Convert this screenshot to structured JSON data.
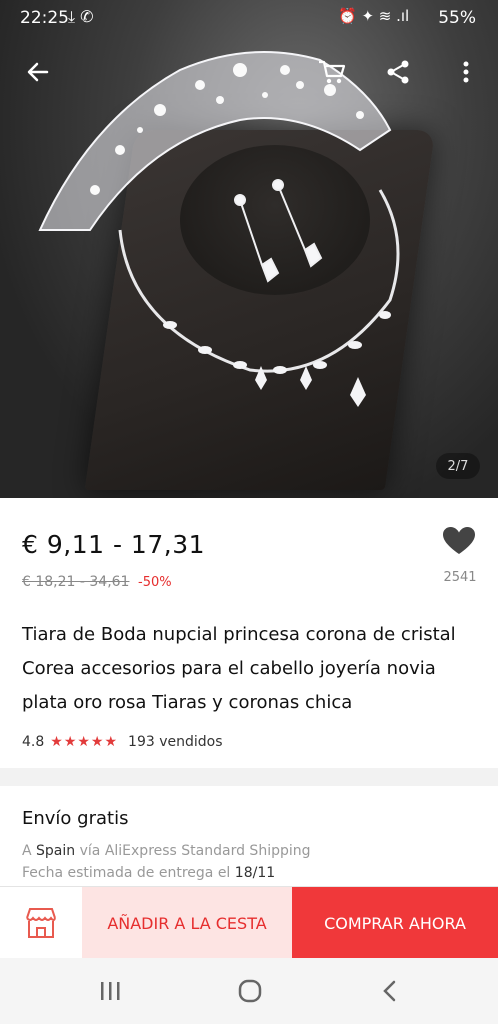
{
  "status_bar": {
    "time": "22:25",
    "battery": "55%"
  },
  "gallery": {
    "pager": "2/7"
  },
  "product": {
    "price": "€ 9,11 - 17,31",
    "old_price": "€ 18,21 - 34,61",
    "discount": "-50%",
    "wishlist_count": "2541",
    "title": "Tiara de Boda nupcial princesa corona de cristal Corea accesorios para el cabello joyería novia plata oro rosa Tiaras y coronas chica",
    "rating": "4.8",
    "stars": "★★★★★",
    "sold": "193 vendidos"
  },
  "shipping": {
    "title": "Envío gratis",
    "route_prefix": "A",
    "destination": "Spain",
    "route_suffix": "vía AliExpress Standard Shipping",
    "date_prefix": "Fecha estimada de entrega el",
    "date": "18/11"
  },
  "actions": {
    "add_to_cart": "AÑADIR A LA CESTA",
    "buy_now": "COMPRAR AHORA"
  },
  "icons": {
    "back": "back-arrow-icon",
    "cart": "cart-icon",
    "share": "share-icon",
    "more": "more-vertical-icon",
    "wishlist": "heart-icon",
    "store": "store-icon"
  },
  "colors": {
    "accent": "#f0383a",
    "accent_light": "#fde4e3",
    "star": "#e23b3b"
  }
}
